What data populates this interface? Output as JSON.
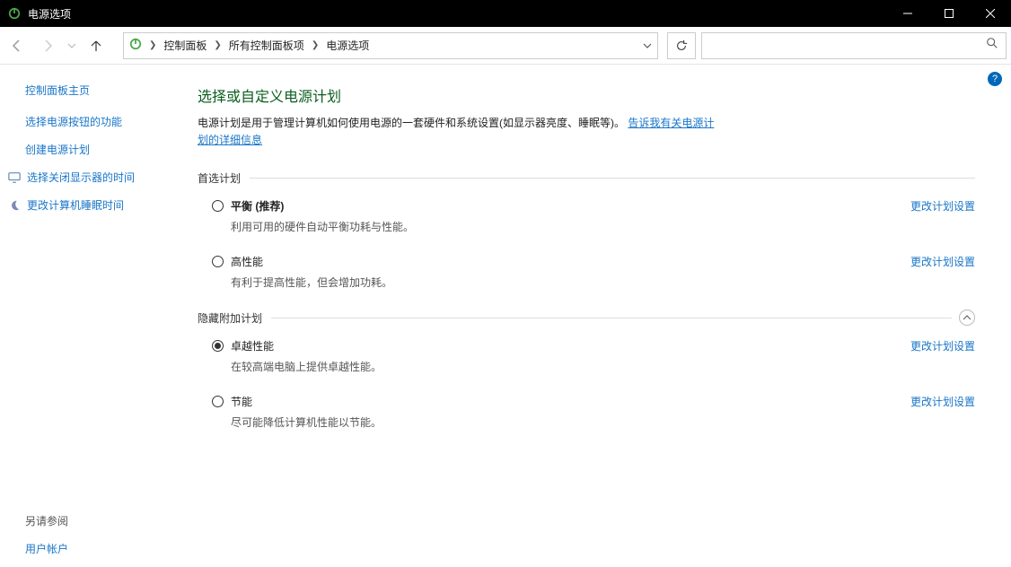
{
  "window": {
    "title": "电源选项"
  },
  "breadcrumb": {
    "items": [
      "控制面板",
      "所有控制面板项",
      "电源选项"
    ]
  },
  "sidebar": {
    "heading": "控制面板主页",
    "links": [
      {
        "label": "选择电源按钮的功能",
        "icon": null
      },
      {
        "label": "创建电源计划",
        "icon": null
      },
      {
        "label": "选择关闭显示器的时间",
        "icon": "monitor"
      },
      {
        "label": "更改计算机睡眠时间",
        "icon": "moon"
      }
    ],
    "see_also_heading": "另请参阅",
    "see_also_link": "用户帐户"
  },
  "main": {
    "title": "选择或自定义电源计划",
    "description": "电源计划是用于管理计算机如何使用电源的一套硬件和系统设置(如显示器亮度、睡眠等)。",
    "description_link": "告诉我有关电源计划的详细信息",
    "section_preferred": "首选计划",
    "section_hidden": "隐藏附加计划",
    "change_plan_label": "更改计划设置",
    "plans_preferred": [
      {
        "name": "平衡",
        "recommend": " (推荐)",
        "sub": "利用可用的硬件自动平衡功耗与性能。",
        "checked": false
      },
      {
        "name": "高性能",
        "recommend": "",
        "sub": "有利于提高性能，但会增加功耗。",
        "checked": false
      }
    ],
    "plans_hidden": [
      {
        "name": "卓越性能",
        "recommend": "",
        "sub": "在较高端电脑上提供卓越性能。",
        "checked": true
      },
      {
        "name": "节能",
        "recommend": "",
        "sub": "尽可能降低计算机性能以节能。",
        "checked": false
      }
    ]
  }
}
